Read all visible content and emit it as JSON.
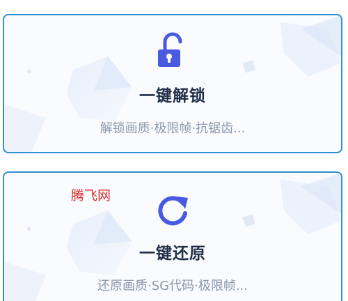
{
  "cards": [
    {
      "icon": "unlock-icon",
      "title": "一键解锁",
      "subtitle": "解锁画质·极限帧·抗锯齿..."
    },
    {
      "icon": "refresh-icon",
      "title": "一键还原",
      "subtitle": "还原画质·SG代码·极限帧..."
    }
  ],
  "watermark": "腾飞网",
  "colors": {
    "card_border": "#2f8fd0",
    "icon_fill": "#4a5ae0",
    "title": "#1f2d47",
    "subtitle": "#8c98ad",
    "watermark": "#d6302e"
  }
}
